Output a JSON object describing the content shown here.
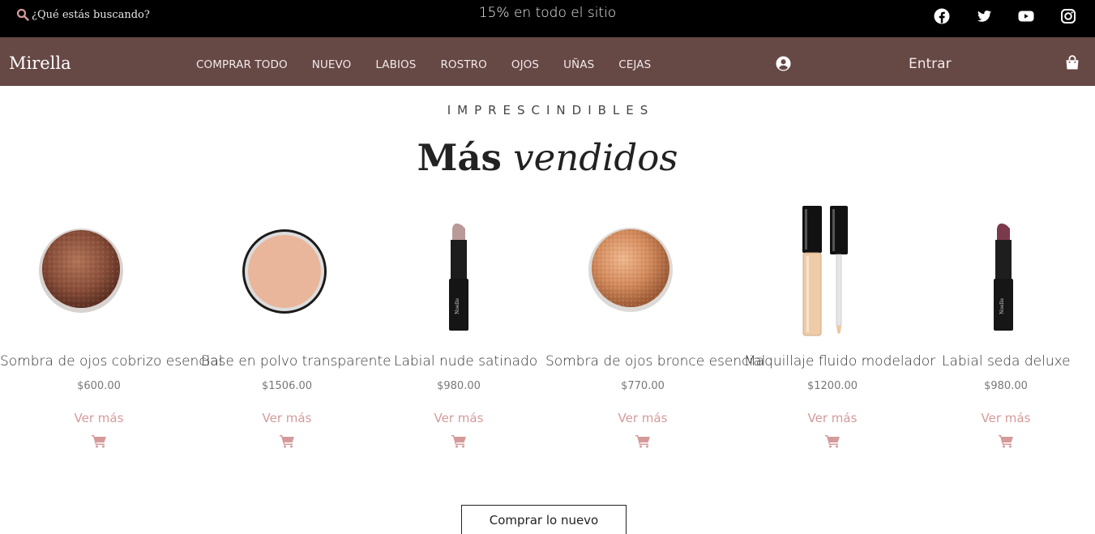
{
  "topbar": {
    "search_placeholder": "¿Qué estás buscando?",
    "promo": "15% en todo el sitio",
    "social": [
      "facebook-icon",
      "twitter-icon",
      "youtube-icon",
      "instagram-icon"
    ]
  },
  "nav": {
    "brand": "Mirella",
    "items": [
      "COMPRAR TODO",
      "NUEVO",
      "LABIOS",
      "ROSTRO",
      "OJOS",
      "UÑAS",
      "CEJAS"
    ],
    "login": "Entrar",
    "background": "#664845"
  },
  "section": {
    "eyebrow": "IMPRESCINDIBLES",
    "title_bold": "Más",
    "title_italic": "vendidos"
  },
  "products": [
    {
      "name": "Sombra de ojos cobrizo esencial",
      "price": "$600.00",
      "more": "Ver más",
      "image": "copper-eyeshadow"
    },
    {
      "name": "Base en polvo transparente",
      "price": "$1506.00",
      "more": "Ver más",
      "image": "powder-compact"
    },
    {
      "name": "Labial nude satinado",
      "price": "$980.00",
      "more": "Ver más",
      "image": "nude-lipstick"
    },
    {
      "name": "Sombra de ojos bronce esencial",
      "price": "$770.00",
      "more": "Ver más",
      "image": "bronze-eyeshadow"
    },
    {
      "name": "Maquillaje fluido modelador",
      "price": "$1200.00",
      "more": "Ver más",
      "image": "fluid-concealer"
    },
    {
      "name": "Labial seda deluxe",
      "price": "$980.00",
      "more": "Ver más",
      "image": "plum-lipstick"
    }
  ],
  "lipstick_brand": "Noelle",
  "cta": "Comprar lo nuevo",
  "colors": {
    "accent": "#d59a9a",
    "topbar": "#000000"
  }
}
